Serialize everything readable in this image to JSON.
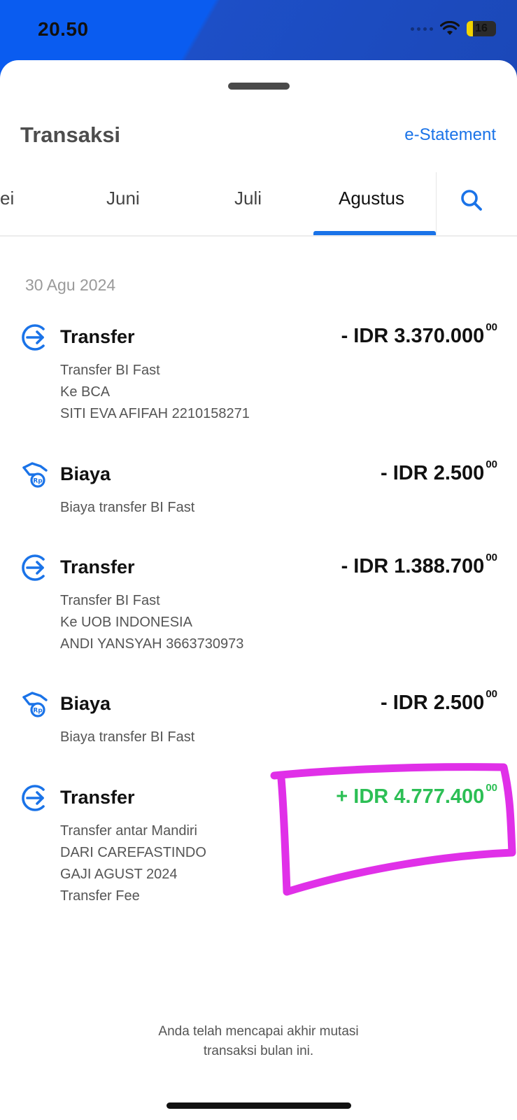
{
  "status_bar": {
    "time": "20.50",
    "battery": "16"
  },
  "header": {
    "title": "Transaksi",
    "estatement_label": "e-Statement"
  },
  "month_tabs": [
    {
      "label": "ei",
      "active": false
    },
    {
      "label": "Juni",
      "active": false
    },
    {
      "label": "Juli",
      "active": false
    },
    {
      "label": "Agustus",
      "active": true
    }
  ],
  "date_header": "30 Agu 2024",
  "transactions": [
    {
      "icon": "transfer-icon",
      "title": "Transfer",
      "amount": "- IDR 3.370.000",
      "cents": "00",
      "direction": "out",
      "details": [
        "Transfer BI Fast",
        "Ke BCA",
        "SITI EVA AFIFAH 2210158271"
      ]
    },
    {
      "icon": "fee-icon",
      "title": "Biaya",
      "amount": "- IDR 2.500",
      "cents": "00",
      "direction": "out",
      "details": [
        "Biaya transfer BI Fast"
      ]
    },
    {
      "icon": "transfer-icon",
      "title": "Transfer",
      "amount": "- IDR 1.388.700",
      "cents": "00",
      "direction": "out",
      "details": [
        "Transfer BI Fast",
        "Ke UOB INDONESIA",
        "ANDI YANSYAH 3663730973"
      ]
    },
    {
      "icon": "fee-icon",
      "title": "Biaya",
      "amount": "- IDR 2.500",
      "cents": "00",
      "direction": "out",
      "details": [
        "Biaya transfer BI Fast"
      ]
    },
    {
      "icon": "transfer-icon",
      "title": "Transfer",
      "amount": "+ IDR 4.777.400",
      "cents": "00",
      "direction": "in",
      "details": [
        "Transfer antar Mandiri",
        "DARI CAREFASTINDO",
        "GAJI AGUST 2024",
        "Transfer Fee"
      ]
    }
  ],
  "footer_note": {
    "line1": "Anda telah mencapai akhir mutasi",
    "line2": "transaksi bulan ini."
  },
  "colors": {
    "accent": "#1a73e8",
    "positive": "#2cbf55",
    "annotation": "#e030e8",
    "header_bg": "#0a5cf0"
  }
}
